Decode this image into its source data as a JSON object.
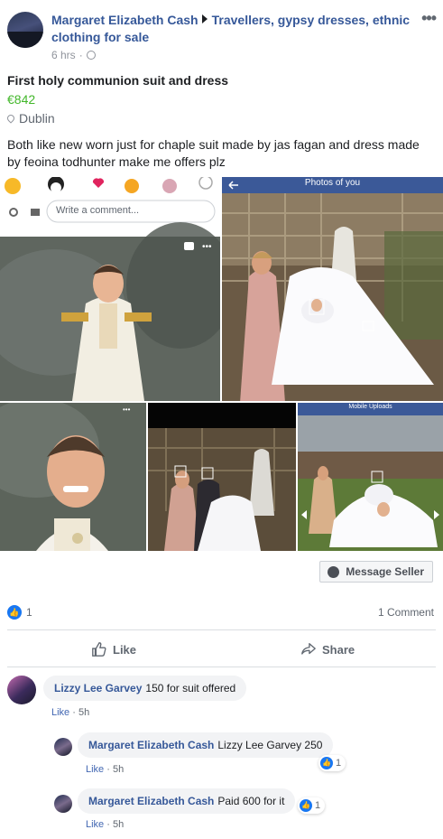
{
  "header": {
    "author": "Margaret Elizabeth Cash",
    "group": "Travellers, gypsy dresses, ethnic clothing for sale",
    "time": "6 hrs",
    "more_label": "•••"
  },
  "listing": {
    "title": "First holy communion suit and dress",
    "price": "€842",
    "location": "Dublin",
    "description": "Both like new worn just for chaple suit made by jas fagan and dress made by feoina todhunter make me offers plz"
  },
  "photos": {
    "p1_overlay": "Write a comment...",
    "p2_header": "Photos of you",
    "p5_header": "Mobile Uploads"
  },
  "message_seller": "Message Seller",
  "summary": {
    "likes": "1",
    "comments": "1 Comment"
  },
  "actions": {
    "like": "Like",
    "share": "Share"
  },
  "comments": [
    {
      "name": "Lizzy Lee Garvey",
      "text": "150 for suit offered",
      "like": "Like",
      "time": "5h"
    },
    {
      "name": "Margaret Elizabeth Cash",
      "text": "Lizzy Lee Garvey 250",
      "like": "Like",
      "time": "5h",
      "reactions": "1"
    },
    {
      "name": "Margaret Elizabeth Cash",
      "text": "Paid 600 for it",
      "like": "Like",
      "time": "5h",
      "reactions": "1"
    }
  ],
  "colors": {
    "link": "#365899",
    "price": "#42b72a",
    "facebook_blue": "#1877f2"
  }
}
